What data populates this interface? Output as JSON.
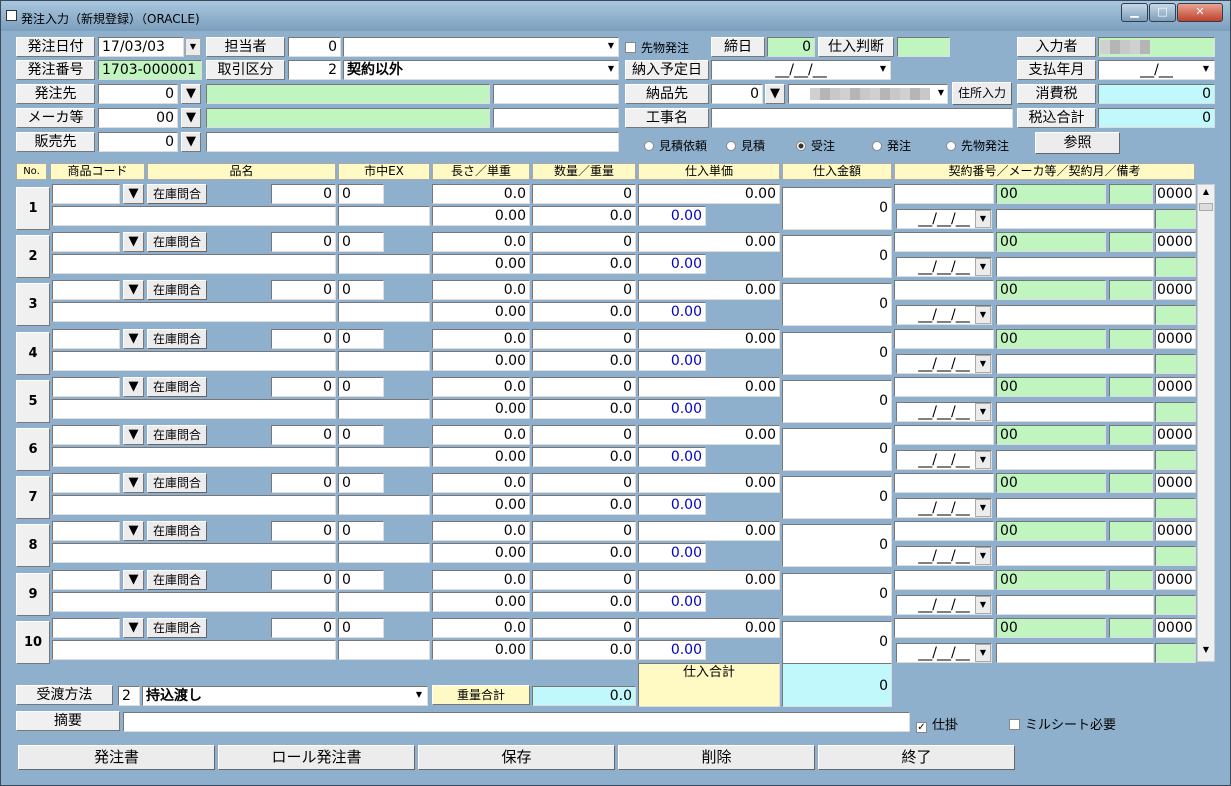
{
  "window": {
    "title": "発注入力（新規登録）（ORACLE)"
  },
  "header": {
    "order_date_label": "発注日付",
    "order_date": "17/03/03",
    "staff_label": "担当者",
    "staff_code": "0",
    "advance_order_label": "先物発注",
    "closing_label": "締日",
    "closing_value": "0",
    "purchase_judge_label": "仕入判断",
    "entered_by_label": "入力者",
    "order_no_label": "発注番号",
    "order_no": "1703-000001",
    "trade_type_label": "取引区分",
    "trade_type_code": "2",
    "trade_type_value": "契約以外",
    "delivery_plan_label": "納入予定日",
    "delivery_plan_value": "__/__/__",
    "pay_month_label": "支払年月",
    "pay_month_value": "__/__",
    "supplier_label": "発注先",
    "supplier_code": "0",
    "delivery_dest_label": "納品先",
    "delivery_dest_code": "0",
    "address_button": "住所入力",
    "tax_label": "消費税",
    "tax_value": "0",
    "maker_label": "メーカ等",
    "maker_code": "00",
    "work_name_label": "工事名",
    "total_tax_label": "税込合計",
    "total_tax_value": "0",
    "seller_label": "販売先",
    "seller_code": "0",
    "radios": [
      "見積依頼",
      "見積",
      "受注",
      "発注",
      "先物発注"
    ],
    "selected_radio": "受注",
    "ref_button": "参照"
  },
  "columns": [
    "No.",
    "商品コード",
    "品名",
    "市中EX",
    "長さ／単重",
    "数量／重量",
    "仕入単価",
    "仕入金額",
    "契約番号／メーカ等／契約月／備考"
  ],
  "row_template": {
    "stock_button": "在庫問合",
    "qty": "0",
    "ex": "0",
    "length": "0.0",
    "amount": "0",
    "unit_price": "0.00",
    "total": "0",
    "maker_code": "00",
    "month_code": "0000",
    "length2": "0.00",
    "weight": "0.0",
    "price_blue": "0.00",
    "date": "__/__/__"
  },
  "rows": [
    "1",
    "2",
    "3",
    "4",
    "5",
    "6",
    "7",
    "8",
    "9",
    "10"
  ],
  "footer": {
    "delivery_method_label": "受渡方法",
    "delivery_method_code": "2",
    "delivery_method_value": "持込渡し",
    "weight_total_label": "重量合計",
    "weight_total_value": "0.0",
    "purchase_total_label": "仕入合計",
    "purchase_total_value": "0",
    "memo_label": "摘要",
    "kakari_label": "仕掛",
    "mill_sheet_label": "ミルシート必要"
  },
  "buttons": [
    "発注書",
    "ロール発注書",
    "保存",
    "削除",
    "終了"
  ]
}
